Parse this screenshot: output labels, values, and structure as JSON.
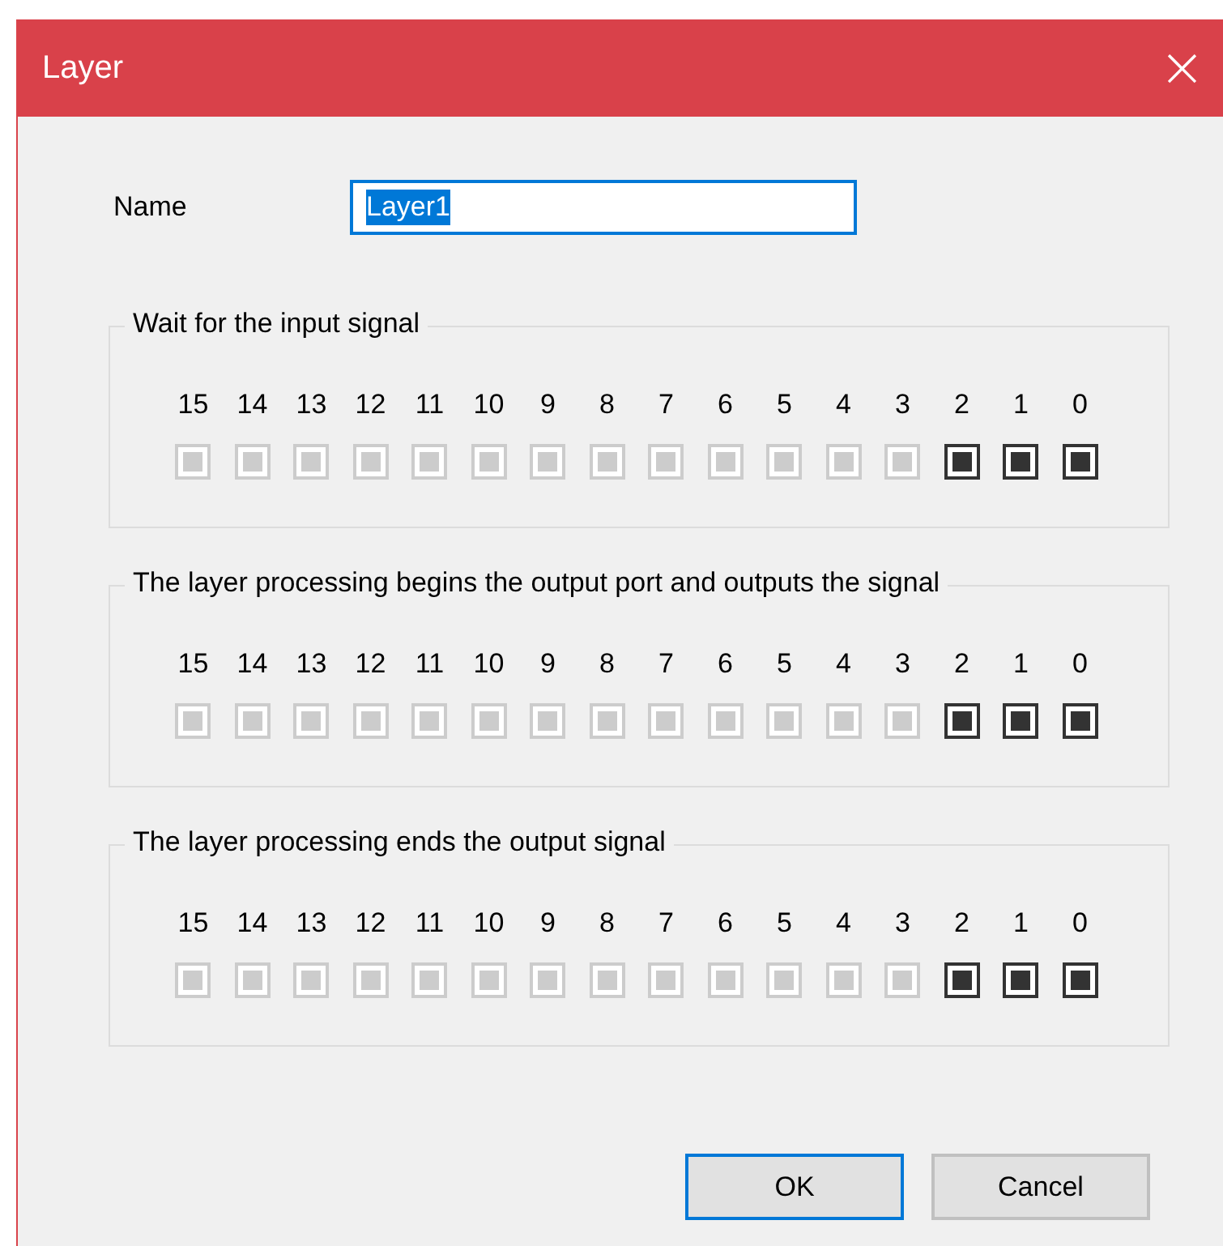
{
  "window": {
    "title": "Layer",
    "close": "×"
  },
  "name_field": {
    "label": "Name",
    "value": "Layer1",
    "text_selected": true
  },
  "groups": [
    {
      "title": "Wait for the input signal",
      "bits": [
        {
          "label": "15",
          "disabled": true
        },
        {
          "label": "14",
          "disabled": true
        },
        {
          "label": "13",
          "disabled": true
        },
        {
          "label": "12",
          "disabled": true
        },
        {
          "label": "11",
          "disabled": true
        },
        {
          "label": "10",
          "disabled": true
        },
        {
          "label": "9",
          "disabled": true
        },
        {
          "label": "8",
          "disabled": true
        },
        {
          "label": "7",
          "disabled": true
        },
        {
          "label": "6",
          "disabled": true
        },
        {
          "label": "5",
          "disabled": true
        },
        {
          "label": "4",
          "disabled": true
        },
        {
          "label": "3",
          "disabled": true
        },
        {
          "label": "2",
          "disabled": false
        },
        {
          "label": "1",
          "disabled": false
        },
        {
          "label": "0",
          "disabled": false
        }
      ]
    },
    {
      "title": "The layer processing begins the output port and outputs the signal",
      "bits": [
        {
          "label": "15",
          "disabled": true
        },
        {
          "label": "14",
          "disabled": true
        },
        {
          "label": "13",
          "disabled": true
        },
        {
          "label": "12",
          "disabled": true
        },
        {
          "label": "11",
          "disabled": true
        },
        {
          "label": "10",
          "disabled": true
        },
        {
          "label": "9",
          "disabled": true
        },
        {
          "label": "8",
          "disabled": true
        },
        {
          "label": "7",
          "disabled": true
        },
        {
          "label": "6",
          "disabled": true
        },
        {
          "label": "5",
          "disabled": true
        },
        {
          "label": "4",
          "disabled": true
        },
        {
          "label": "3",
          "disabled": true
        },
        {
          "label": "2",
          "disabled": false
        },
        {
          "label": "1",
          "disabled": false
        },
        {
          "label": "0",
          "disabled": false
        }
      ]
    },
    {
      "title": "The layer processing ends the output signal",
      "bits": [
        {
          "label": "15",
          "disabled": true
        },
        {
          "label": "14",
          "disabled": true
        },
        {
          "label": "13",
          "disabled": true
        },
        {
          "label": "12",
          "disabled": true
        },
        {
          "label": "11",
          "disabled": true
        },
        {
          "label": "10",
          "disabled": true
        },
        {
          "label": "9",
          "disabled": true
        },
        {
          "label": "8",
          "disabled": true
        },
        {
          "label": "7",
          "disabled": true
        },
        {
          "label": "6",
          "disabled": true
        },
        {
          "label": "5",
          "disabled": true
        },
        {
          "label": "4",
          "disabled": true
        },
        {
          "label": "3",
          "disabled": true
        },
        {
          "label": "2",
          "disabled": false
        },
        {
          "label": "1",
          "disabled": false
        },
        {
          "label": "0",
          "disabled": false
        }
      ]
    }
  ],
  "buttons": [
    {
      "label": "OK",
      "selected": true
    },
    {
      "label": "Cancel",
      "selected": false
    }
  ]
}
